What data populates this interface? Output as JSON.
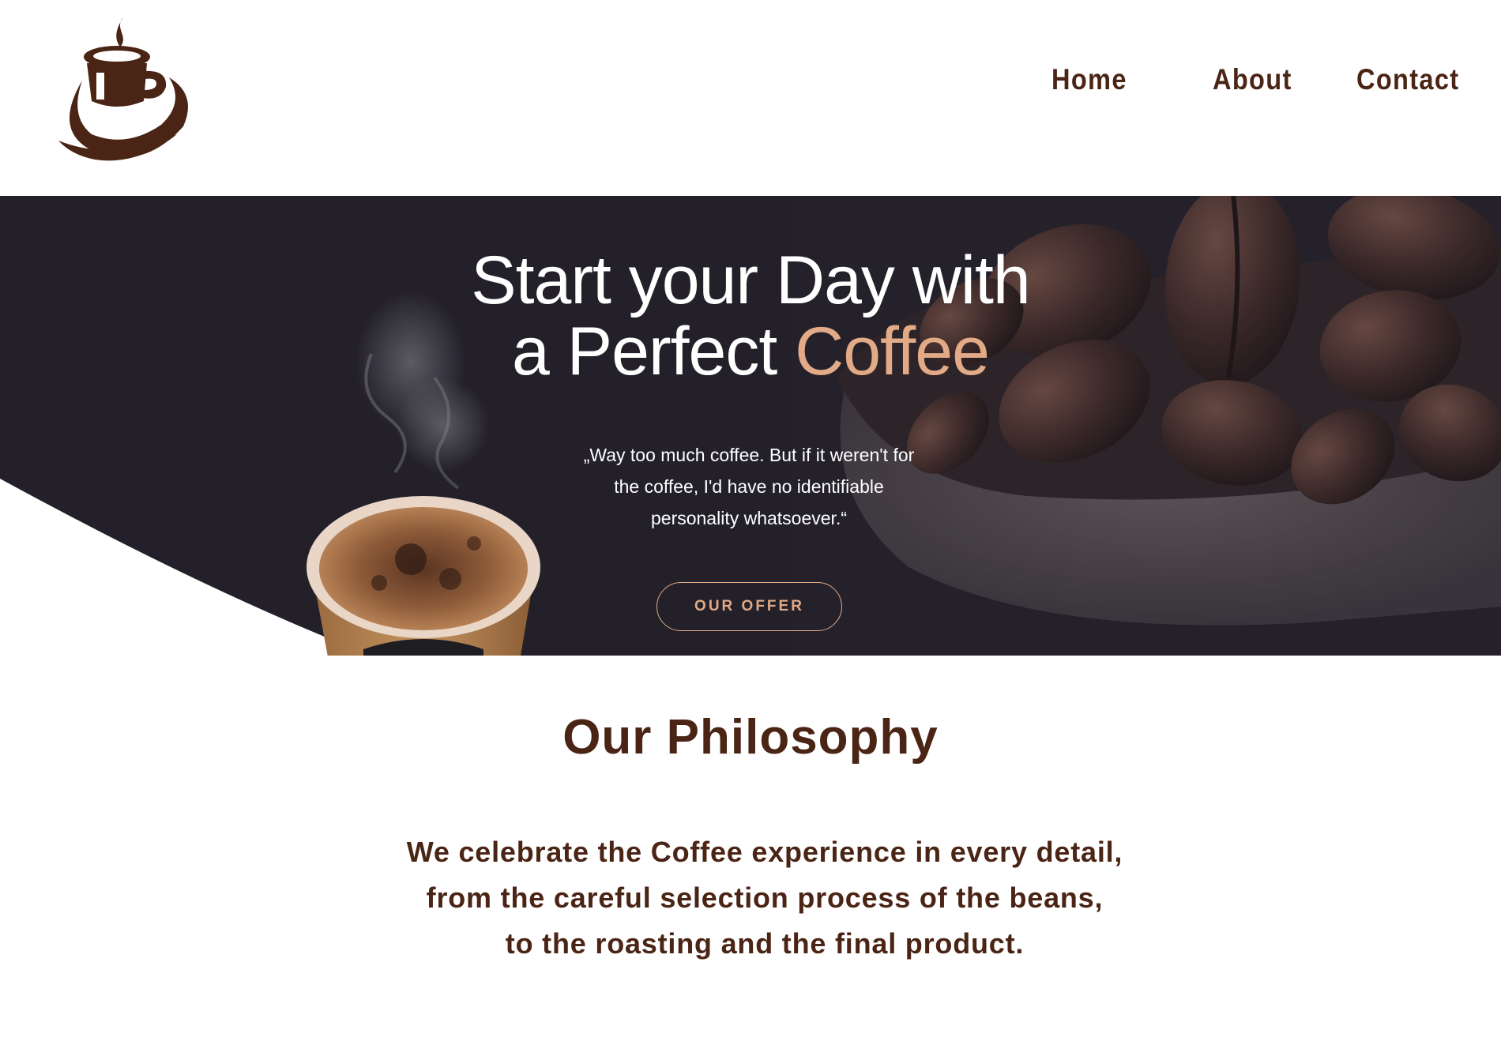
{
  "header": {
    "logo_icon": "coffee-cup-logo-icon",
    "nav": {
      "home": "Home",
      "about": "About",
      "contact": "Contact"
    }
  },
  "hero": {
    "title_line1": "Start your Day with",
    "title_line2_prefix": "a Perfect ",
    "title_line2_accent": "Coffee",
    "quote_line1": "„Way too much coffee. But if it weren't for",
    "quote_line2": "the coffee, I'd have no identifiable",
    "quote_line3": "personality whatsoever.“",
    "cta_label": "OUR OFFER",
    "images": [
      "coffee-beans-bowl-image",
      "coffee-cup-steam-image"
    ]
  },
  "philosophy": {
    "title": "Our Philosophy",
    "line1": "We celebrate the Coffee experience in every detail,",
    "line2": "from the careful selection process of the beans,",
    "line3": "to the roasting and the final product."
  },
  "colors": {
    "brand_brown": "#4a2414",
    "accent_tan": "#e2aa86",
    "hero_dark": "#23202a",
    "white": "#ffffff"
  }
}
